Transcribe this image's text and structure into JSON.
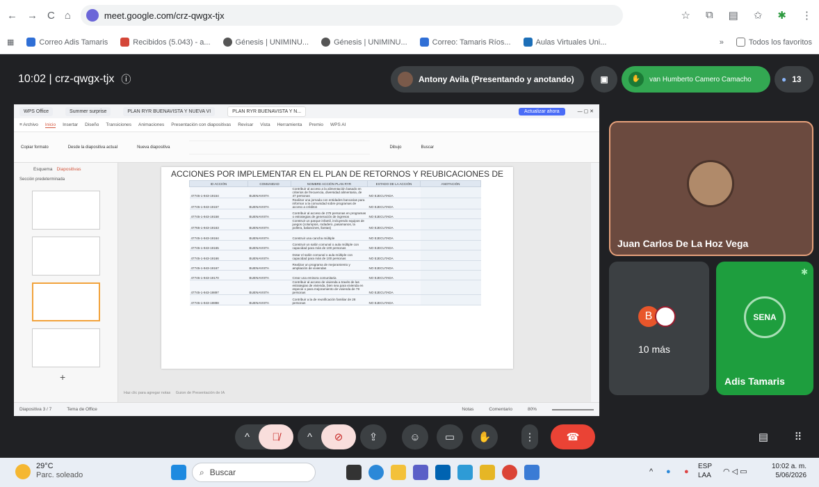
{
  "browser": {
    "url": "meet.google.com/crz-qwgx-tjx",
    "bookmarks": [
      "Correo Adis Tamaris",
      "Recibidos (5.043) - a...",
      "Génesis | UNIMINU...",
      "Génesis | UNIMINU...",
      "Correo: Tamaris Ríos...",
      "Aulas Virtuales Uni..."
    ],
    "bookmarks_more": "»",
    "all_favorites": "Todos los favoritos"
  },
  "meet": {
    "time_code": "10:02 | crz-qwgx-tjx",
    "presenter": "Antony Avila (Presentando y anotando)",
    "active_speaker": "van Humberto Camero Camacho",
    "participant_count": "13",
    "main_tile_name": "Juan Carlos De La Hoz Vega",
    "others_label": "10 más",
    "avatar_initial": "B",
    "sena_tile_name": "Adis Tamaris",
    "sena_logo_text": "SENA"
  },
  "wps": {
    "tabs": [
      "WPS Office",
      "Summer surprise",
      "PLAN RYR BUENAVISTA Y NUEVA VI",
      "PLAN RYR BUENAVISTA Y N..."
    ],
    "update_button": "Actualizar ahora",
    "menu": [
      "≡ Archivo",
      "Inicio",
      "Insertar",
      "Diseño",
      "Transiciones",
      "Animaciones",
      "Presentación con diapositivas",
      "Revisar",
      "Vista",
      "Herramienta",
      "Premio",
      "WPS AI"
    ],
    "ribbon": [
      "Copiar formato",
      "Desde la diapositiva actual",
      "Nueva diapositiva",
      "Dibujo",
      "Buscar"
    ],
    "panel_tabs": [
      "Esquema",
      "Diapositivas"
    ],
    "section_label": "Sección predeterminada",
    "slide_title": "ACCIONES POR IMPLEMENTAR EN EL PLAN DE RETORNOS Y REUBICACIONES DE BUENAVISTA",
    "table_headers": [
      "ID ACCIÓN",
      "COMUNIDAD",
      "NOMBRE ACCIÓN PLAN RYR",
      "ESTADO DE LA ACCIÓN",
      "ANOTACIÓN"
    ],
    "rows": [
      {
        "id": "47745-1-943-19154",
        "comunidad": "BUENAVISTA",
        "accion": "Contribuir al acceso a la alimentación basado en criterios de frecuencia, diversidad alimentaria, de 47 personas",
        "estado": "NO EJECUTADA"
      },
      {
        "id": "47745-1-943-19157",
        "comunidad": "BUENAVISTA",
        "accion": "Realizar una jornada con entidades bancarias para informar a la comunidad sobre programas de acceso a créditos",
        "estado": "NO EJECUTADA"
      },
      {
        "id": "47745-1-943-19158",
        "comunidad": "BUENAVISTA",
        "accion": "Contribuir al acceso de 278 personas en programas o estrategias de generación de ingresos",
        "estado": "NO EJECUTADA"
      },
      {
        "id": "47765-1-943-19163",
        "comunidad": "BUENAVISTA",
        "accion": "Construir un parque infantil, incluyendo equipos de juegos (columpios, rodadero, pasamanos, la pollera, balancines, llantas)",
        "estado": "NO EJECUTADA"
      },
      {
        "id": "47745-1-943-19164",
        "comunidad": "BUENAVISTA",
        "accion": "Construir una cancha múltiple",
        "estado": "NO EJECUTADA"
      },
      {
        "id": "47745-1-943-19165",
        "comunidad": "BUENAVISTA",
        "accion": "Construir un salón comunal o aula múltiple con capacidad para más de 100 personas",
        "estado": "NO EJECUTADA"
      },
      {
        "id": "47745-1-943-19166",
        "comunidad": "BUENAVISTA",
        "accion": "Dotar el salón comunal o aula múltiple con capacidad para más de 100 personas",
        "estado": "NO EJECUTADA"
      },
      {
        "id": "47745-1-943-19167",
        "comunidad": "BUENAVISTA",
        "accion": "Realizar un programa de mejoramiento y ampliación de viviendas",
        "estado": "NO EJECUTADA"
      },
      {
        "id": "47745-1-943-19170",
        "comunidad": "BUENAVISTA",
        "accion": "Crear una emisora comunitaria",
        "estado": "NO EJECUTADA"
      },
      {
        "id": "47745-1-943-19897",
        "comunidad": "BUENAVISTA",
        "accion": "Contribuir al acceso de vivienda a través de las estrategias de vivienda, bien sea para vivienda en especie o para mejoramiento de vivienda de 79 personas",
        "estado": "NO EJECUTADA"
      },
      {
        "id": "47745-1-943-19898",
        "comunidad": "BUENAVISTA",
        "accion": "Contribuir a la de reunificación familiar de 28 personas",
        "estado": "NO EJECUTADA"
      }
    ],
    "notes_placeholder": "Haz clic para agregar notas",
    "notes_guide": "Guion de Presentación de IA",
    "status_slide": "Diapositiva 3 / 7",
    "status_theme": "Tema de Office",
    "status_notes": "Notas",
    "status_comments": "Comentario",
    "zoom": "80%"
  },
  "taskbar": {
    "temp": "29°C",
    "weather": "Parc. soleado",
    "search_placeholder": "Buscar",
    "lang": "ESP",
    "lang2": "LAA",
    "clock_time": "10:02 a. m.",
    "clock_date": "5/06/2026"
  },
  "colors": {
    "meet_bg": "#202124",
    "end_call": "#ea4335",
    "speaker_green": "#33a852",
    "sena_green": "#1e9e3e"
  }
}
